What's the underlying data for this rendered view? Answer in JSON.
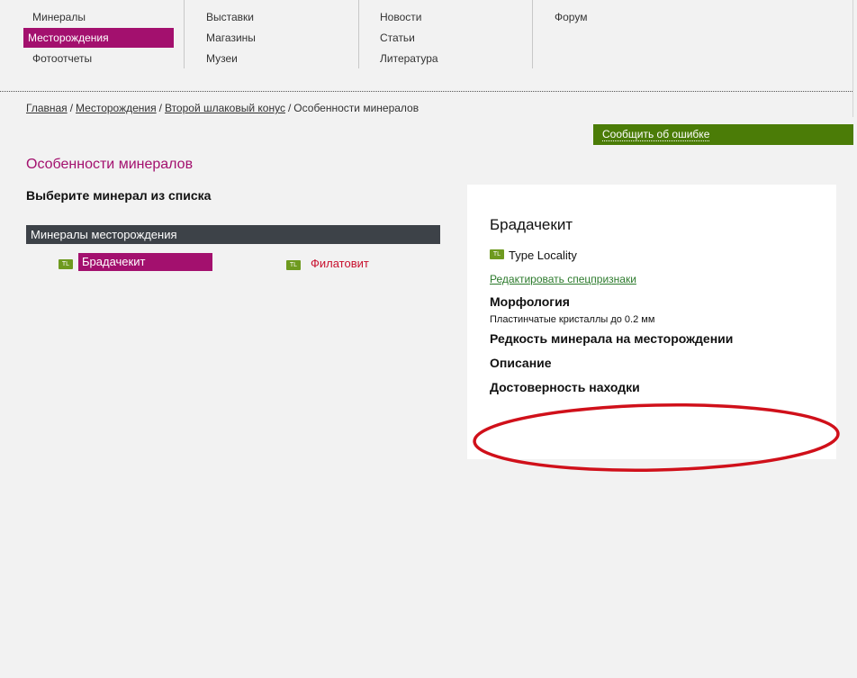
{
  "nav": {
    "col1": [
      "Минералы",
      "Месторождения",
      "Фотоотчеты"
    ],
    "col2": [
      "Выставки",
      "Магазины",
      "Музеи"
    ],
    "col3": [
      "Новости",
      "Статьи",
      "Литература"
    ],
    "col4": [
      "Форум"
    ],
    "active": "Месторождения"
  },
  "breadcrumb": {
    "items": [
      "Главная",
      "Месторождения",
      "Второй шлаковый конус"
    ],
    "current": "Особенности минералов",
    "separator": "/"
  },
  "report_error": "Сообщить об ошибке",
  "page_title": "Особенности минералов",
  "choose_label": "Выберите минерал из списка",
  "minerals_header": "Минералы месторождения",
  "minerals": [
    {
      "badge": "TL",
      "name": "Брадачекит",
      "selected": true
    },
    {
      "badge": "TL",
      "name": "Филатовит",
      "selected": false
    }
  ],
  "detail": {
    "title": "Брадачекит",
    "badge": "TL",
    "type_locality": "Type Locality",
    "edit_link": "Редактировать спецпризнаки",
    "morphology_heading": "Морфология",
    "morphology_text": "Пластинчатые кристаллы до 0.2 мм",
    "rarity_heading": "Редкость минерала на месторождении",
    "description_heading": "Описание",
    "reliability_heading": "Достоверность находки"
  },
  "colors": {
    "accent": "#a3106e",
    "report_bar": "#4b7c07",
    "header_bar": "#3d4248",
    "badge": "#6e9a1f",
    "annotation": "#d0101a"
  }
}
